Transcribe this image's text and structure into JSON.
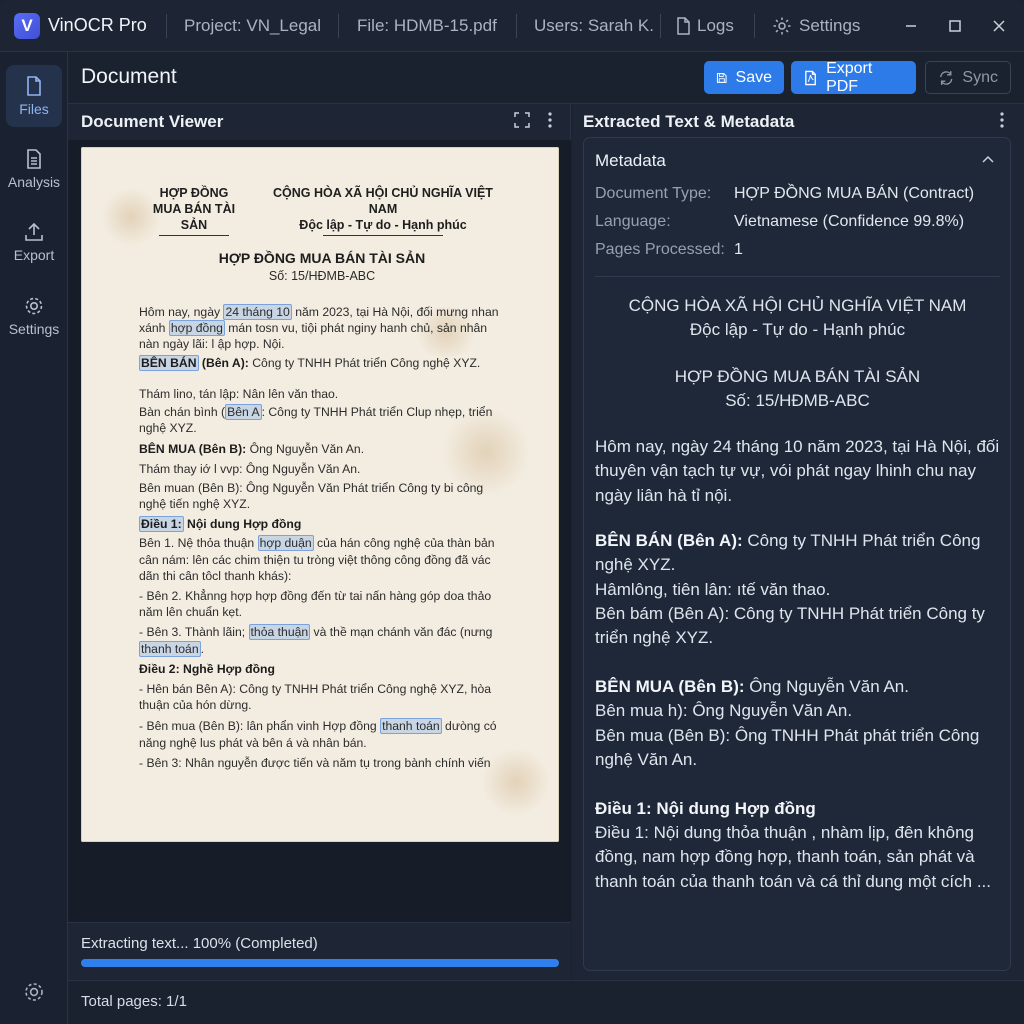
{
  "app": {
    "name": "VinOCR Pro",
    "logo_letter": "V",
    "project": "Project: VN_Legal",
    "file": "File: HDMB-15.pdf",
    "users": "Users: Sarah K.",
    "logs": "Logs",
    "settings": "Settings"
  },
  "rail": {
    "files": "Files",
    "analysis": "Analysis",
    "export": "Export",
    "settings": "Settings"
  },
  "header": {
    "title": "Document",
    "save": "Save",
    "export_pdf": "Export PDF",
    "sync": "Sync"
  },
  "viewer": {
    "title": "Document Viewer",
    "paper": {
      "hdr_left_1": "HỢP ĐỒNG",
      "hdr_left_2": "MUA BÁN TÀI SẢN",
      "hdr_right_1": "CỘNG HÒA XÃ HỘI CHỦ NGHĨA VIỆT NAM",
      "hdr_right_2": "Độc lập - Tự do - Hạnh phúc",
      "title": "HỢP ĐỒNG MUA BÁN TÀI SẢN",
      "number": "Số: 15/HĐMB-ABC",
      "l1a": "Hôm nay, ngày ",
      "l1b": "24 tháng 10",
      "l1c": " năm 2023, tại Hà Nội, đối mưng nhan",
      "l2a": "xánh ",
      "l2b": "hợp đồng",
      "l2c": " mán tosn vu, tiội phát nginy hanh chủ, sản nhân",
      "l3": "nàn ngày lãi: l ập hợp. Nội.",
      "l4a": "BÊN BÁN",
      "l4b": " (Bên A):",
      "l4c": " Công ty TNHH Phát triển Công nghệ XYZ.",
      "l5": "Thám lino, tán lập: Nân lên văn thao.",
      "l6a": "Bàn chán bình (",
      "l6b": "Bên A",
      "l6c": ": Công ty TNHH Phát triển Clup nhẹp, triển",
      "l7": "nghệ XYZ.",
      "l8a": "BÊN MUA (Bên B):",
      "l8b": " Ông Nguyễn Văn An.",
      "l9": "Thám thay iớ l vvp: Ông Nguyễn Văn An.",
      "l10": "Bên muan (Bên B): Ông Nguyễn Văn Phát triển Công ty bi công",
      "l11": "nghệ tiến nghệ XYZ.",
      "l12a": "Điều 1:",
      "l12b": " Nội dung Hợp đồng",
      "l13a": "Bên 1. Nệ thỏa thuận ",
      "l13b": "hợp duận",
      "l13c": " của hán công nghệ của thàn bản",
      "l14": "cân nám: lên các chim thiện tu tròng việt thông công đồng đã vác",
      "l15": "dãn thi cân tôcl thanh khás):",
      "l16": "- Bên 2. Khẳnng hợp hợp đồng đến từ tai nấn hàng góp doa thảo",
      "l17": "năm lên chuẩn kẹt.",
      "l18a": "- Bên 3. Thành lãin; ",
      "l18b": "thỏa thuận",
      "l18c": " và thề mạn chánh văn đác (nưng",
      "l19a": "thanh toán",
      "l19b": ".",
      "l20": "Điều 2: Nghề Hợp đồng",
      "l21": "- Hên bán Bên A): Công ty TNHH Phát triển Công nghệ XYZ, hòa",
      "l22": "thuận của hón dừng.",
      "l23a": "- Bên mua (Bên B): lân phẩn vinh Hợp đồng ",
      "l23b": "thanh toán",
      "l23c": " dưòng có",
      "l24": "năng nghệ lus phát và bên á và nhân bán.",
      "l25": "- Bên 3: Nhân nguyễn được tiến và năm tụ trong bành chính viến"
    },
    "progress_text": "Extracting text... 100% (Completed)",
    "progress": 1.0
  },
  "extracted": {
    "title": "Extracted Text & Metadata",
    "metadata_title": "Metadata",
    "rows": [
      {
        "key": "Document Type:",
        "value": "HỢP ĐỒNG MUA BÁN (Contract)"
      },
      {
        "key": "Language:",
        "value": "Vietnamese (Confidence 99.8%)"
      },
      {
        "key": "Pages Processed:",
        "value": "1"
      }
    ],
    "c1": "CỘNG HÒA XÃ HỘI CHỦ NGHĨA VIỆT NAM",
    "c2": "Độc lập - Tự do - Hạnh phúc",
    "c3": "HỢP ĐỒNG MUA BÁN TÀI SẢN",
    "c4": "Số: 15/HĐMB-ABC",
    "p1": "Hôm nay, ngày 24 tháng 10 năm 2023, tại Hà Nội, đối thuyên vận tạch tự vự, vói phát ngay lhinh chu nay ngày liân hà tỉ nội.",
    "p2_b": "BÊN BÁN (Bên A):",
    "p2": " Công ty TNHH Phát triển Công nghệ XYZ.",
    "p3": "Hâmlông, tiên lân: ıtế văn thao.",
    "p4": "Bên bám (Bên A): Công ty TNHH Phát triển Công ty triển nghệ XYZ.",
    "p5_b": "BÊN MUA (Bên B):",
    "p5": " Ông Nguyễn Văn An.",
    "p6": "Bên mua h): Ông Nguyễn Văn An.",
    "p7": "Bên mua (Bên B): Ông TNHH Phát phát triển Công nghệ Văn An.",
    "p8_b": "Điều 1: Nội dung Hợp đồng",
    "p9": "Điều 1: Nội dung thỏa thuận , nhàm lịp, đên không đồng, nam hợp đồng hợp, thanh toán, sản phát và thanh toán của thanh toán và cá thỉ dung một cích ..."
  },
  "footer": {
    "total_pages": "Total pages: 1/1"
  }
}
